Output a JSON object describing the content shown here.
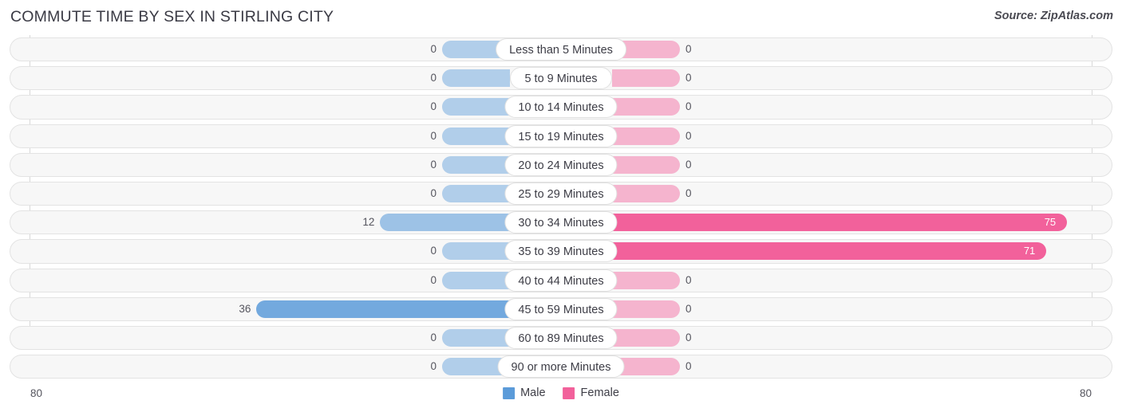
{
  "header": {
    "title": "COMMUTE TIME BY SEX IN STIRLING CITY",
    "source": "Source: ZipAtlas.com"
  },
  "axis": {
    "left_label": "80",
    "right_label": "80"
  },
  "legend": {
    "items": [
      {
        "label": "Male",
        "color": "#5b9bd9"
      },
      {
        "label": "Female",
        "color": "#f2619b"
      }
    ]
  },
  "chart_data": {
    "type": "bar",
    "subtype": "diverging-horizontal-bar",
    "title": "COMMUTE TIME BY SEX IN STIRLING CITY",
    "xlabel": "",
    "ylabel": "",
    "xlim": [
      80,
      80
    ],
    "axis_max": 80,
    "grid": true,
    "legend_position": "bottom-center",
    "categories": [
      "Less than 5 Minutes",
      "5 to 9 Minutes",
      "10 to 14 Minutes",
      "15 to 19 Minutes",
      "20 to 24 Minutes",
      "25 to 29 Minutes",
      "30 to 34 Minutes",
      "35 to 39 Minutes",
      "40 to 44 Minutes",
      "45 to 59 Minutes",
      "60 to 89 Minutes",
      "90 or more Minutes"
    ],
    "series": [
      {
        "name": "Male",
        "color": "#5b9bd9",
        "values": [
          0,
          0,
          0,
          0,
          0,
          0,
          12,
          0,
          0,
          36,
          0,
          0
        ]
      },
      {
        "name": "Female",
        "color": "#f2619b",
        "values": [
          0,
          0,
          0,
          0,
          0,
          0,
          75,
          71,
          0,
          0,
          0,
          0
        ]
      }
    ]
  },
  "rows": [
    {
      "label": "Less than 5 Minutes",
      "male": "0",
      "female": "0"
    },
    {
      "label": "5 to 9 Minutes",
      "male": "0",
      "female": "0"
    },
    {
      "label": "10 to 14 Minutes",
      "male": "0",
      "female": "0"
    },
    {
      "label": "15 to 19 Minutes",
      "male": "0",
      "female": "0"
    },
    {
      "label": "20 to 24 Minutes",
      "male": "0",
      "female": "0"
    },
    {
      "label": "25 to 29 Minutes",
      "male": "0",
      "female": "0"
    },
    {
      "label": "30 to 34 Minutes",
      "male": "12",
      "female": "75"
    },
    {
      "label": "35 to 39 Minutes",
      "male": "0",
      "female": "71"
    },
    {
      "label": "40 to 44 Minutes",
      "male": "0",
      "female": "0"
    },
    {
      "label": "45 to 59 Minutes",
      "male": "36",
      "female": "0"
    },
    {
      "label": "60 to 89 Minutes",
      "male": "0",
      "female": "0"
    },
    {
      "label": "90 or more Minutes",
      "male": "0",
      "female": "0"
    }
  ]
}
